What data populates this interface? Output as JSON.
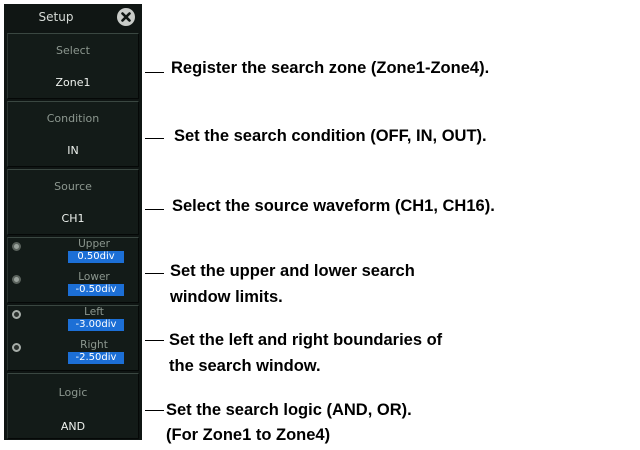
{
  "panel": {
    "title": "Setup",
    "select": {
      "label": "Select",
      "value": "Zone1"
    },
    "condition": {
      "label": "Condition",
      "value": "IN"
    },
    "source": {
      "label": "Source",
      "value": "CH1"
    },
    "upper": {
      "label": "Upper",
      "value": "0.50div"
    },
    "lower": {
      "label": "Lower",
      "value": "-0.50div"
    },
    "left": {
      "label": "Left",
      "value": "-3.00div"
    },
    "right": {
      "label": "Right",
      "value": "-2.50div"
    },
    "logic": {
      "label": "Logic",
      "value": "AND"
    }
  },
  "annotations": {
    "select": "Register the search zone (Zone1-Zone4).",
    "condition": "Set the search condition (OFF, IN, OUT).",
    "source": "Select the source waveform (CH1, CH16).",
    "upper_lower_1": "Set the upper and lower search",
    "upper_lower_2": "window limits.",
    "left_right_1": "Set the left and right boundaries of",
    "left_right_2": "the search window.",
    "logic_1": "Set the search logic (AND, OR).",
    "logic_2": "(For Zone1 to Zone4)"
  }
}
